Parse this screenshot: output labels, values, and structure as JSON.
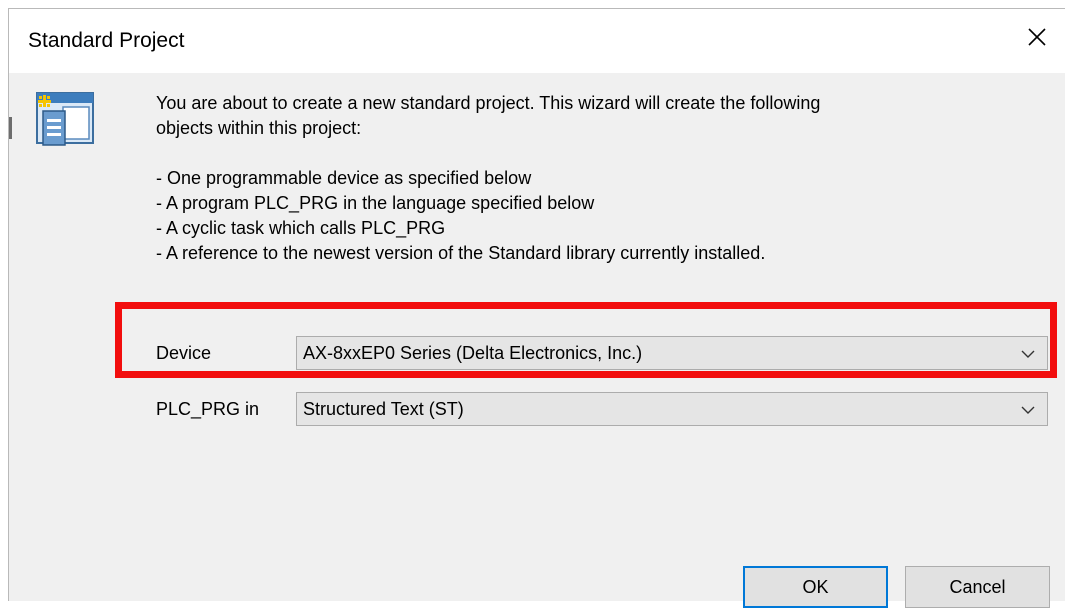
{
  "dialog": {
    "title": "Standard Project",
    "close_icon": "close-icon"
  },
  "message": {
    "intro_line1": "You are about to create a new standard project. This wizard will create the following",
    "intro_line2": "objects within this project:",
    "items": [
      "- One programmable device as specified below",
      "- A program PLC_PRG in the language specified below",
      "- A cyclic task which calls PLC_PRG",
      "- A reference to the newest version of the Standard library currently installed."
    ]
  },
  "fields": {
    "device": {
      "label": "Device",
      "value": "AX-8xxEP0 Series (Delta Electronics, Inc.)"
    },
    "plc_prg": {
      "label": "PLC_PRG in",
      "value": "Structured Text (ST)"
    }
  },
  "buttons": {
    "ok_label": "OK",
    "cancel_label": "Cancel"
  },
  "colors": {
    "highlight": "#f20e0e",
    "dialog_bg": "#f0f0f0",
    "default_button_border": "#0078d7"
  }
}
